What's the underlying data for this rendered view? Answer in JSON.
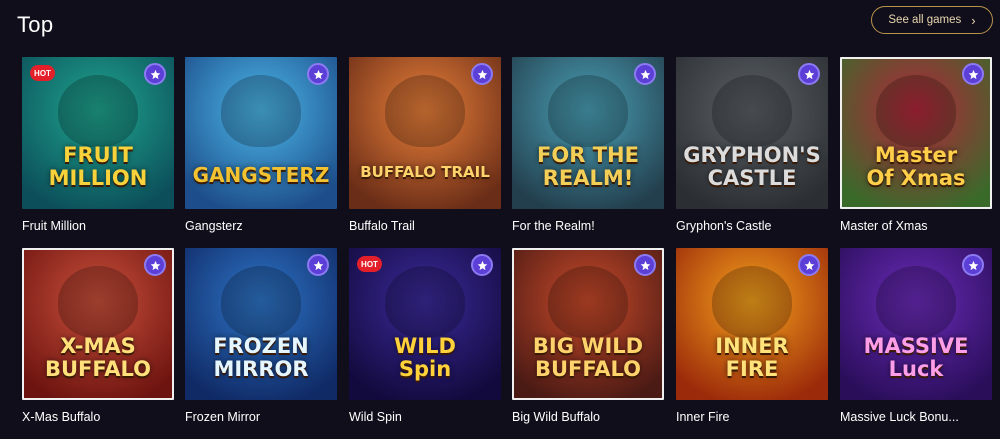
{
  "section": {
    "title": "Top",
    "see_all_label": "See all games"
  },
  "badges": {
    "hot": "HOT"
  },
  "games": [
    {
      "title": "Fruit Million",
      "logo": [
        "FRUIT",
        "MILLION"
      ],
      "hot": true,
      "bg": [
        "#1fa58e",
        "#0c4f5a"
      ],
      "logo_color": "#f7d23a"
    },
    {
      "title": "Gangsterz",
      "logo": [
        "GANGSTERZ"
      ],
      "hot": false,
      "bg": [
        "#4bb7e8",
        "#1d4d8a"
      ],
      "logo_color": "#f2c230"
    },
    {
      "title": "Buffalo Trail",
      "logo": [
        "BUFFALO TRAIL"
      ],
      "hot": false,
      "bg": [
        "#e9803a",
        "#6a2d17"
      ],
      "logo_color": "#ffd36b"
    },
    {
      "title": "For the Realm!",
      "logo": [
        "FOR THE",
        "REALM!"
      ],
      "hot": false,
      "bg": [
        "#4aa0b6",
        "#233f4d"
      ],
      "logo_color": "#f4cf58"
    },
    {
      "title": "Gryphon's Castle",
      "logo": [
        "GRYPHON'S",
        "CASTLE"
      ],
      "hot": false,
      "bg": [
        "#5b6066",
        "#2b2f33"
      ],
      "logo_color": "#dcdcdc"
    },
    {
      "title": "Master of Xmas",
      "logo": [
        "Master",
        "Of Xmas"
      ],
      "hot": false,
      "bg": [
        "#b2253a",
        "#3a6a2a"
      ],
      "logo_color": "#ffcf4a"
    },
    {
      "title": "X-Mas Buffalo",
      "logo": [
        "X-MAS",
        "BUFFALO"
      ],
      "hot": false,
      "bg": [
        "#c9503b",
        "#6e1410"
      ],
      "logo_color": "#ffe07a"
    },
    {
      "title": "Frozen Mirror",
      "logo": [
        "FROZEN",
        "MIRROR"
      ],
      "hot": false,
      "bg": [
        "#2e76c8",
        "#102a66"
      ],
      "logo_color": "#e6f6ff"
    },
    {
      "title": "Wild Spin",
      "logo": [
        "WILD",
        "Spin"
      ],
      "hot": true,
      "bg": [
        "#3b2a9a",
        "#120a3d"
      ],
      "logo_color": "#ffd23c"
    },
    {
      "title": "Big Wild Buffalo",
      "logo": [
        "BIG WILD",
        "BUFFALO"
      ],
      "hot": false,
      "bg": [
        "#c94a2a",
        "#4a1a14"
      ],
      "logo_color": "#ffd36b"
    },
    {
      "title": "Inner Fire",
      "logo": [
        "INNER",
        "FIRE"
      ],
      "hot": false,
      "bg": [
        "#f5a21c",
        "#9b2a0a"
      ],
      "logo_color": "#ffe27a"
    },
    {
      "title": "Massive Luck Bonu...",
      "logo": [
        "MASSIVE",
        "Luck"
      ],
      "hot": false,
      "bg": [
        "#6a2bb8",
        "#2a0e5a"
      ],
      "logo_color": "#ff9ee8"
    }
  ]
}
